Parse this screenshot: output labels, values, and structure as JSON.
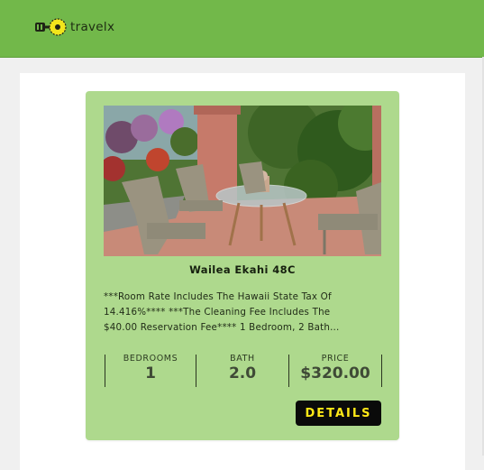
{
  "header": {
    "logo_text": "travelx",
    "colors": {
      "bar": "#72b84a",
      "logo_accent": "#f2e51c"
    }
  },
  "listing": {
    "title": "Wailea Ekahi 48C",
    "description": "***Room Rate Includes The Hawaii State Tax Of\n14.416%**** ***The Cleaning Fee Includes The\n$40.00 Reservation Fee**** 1 Bedroom, 2 Bath...",
    "stats": [
      {
        "label": "BEDROOMS",
        "value": "1"
      },
      {
        "label": "BATH",
        "value": "2.0"
      },
      {
        "label": "PRICE",
        "value": "$320.00"
      }
    ],
    "details_label": "DETAILS",
    "colors": {
      "card": "#aed98d",
      "button_bg": "#0a0a0a",
      "button_text": "#ffe817"
    }
  }
}
